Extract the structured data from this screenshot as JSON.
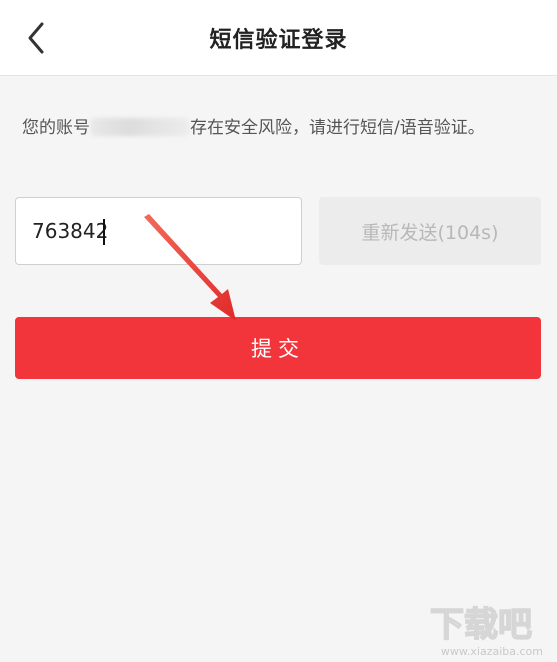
{
  "header": {
    "title": "短信验证登录",
    "back_icon": "chevron-left-icon"
  },
  "notice": {
    "prefix": "您的账号",
    "suffix": "存在安全风险，请进行短信/语音验证。"
  },
  "code_input": {
    "value": "763842",
    "placeholder": ""
  },
  "resend_button": {
    "label": "重新发送(104s)"
  },
  "submit_button": {
    "label": "提交"
  },
  "watermark": {
    "brand": "下载吧",
    "url": "www.xiazaiba.com"
  },
  "colors": {
    "primary": "#f2353b",
    "header_bg": "#ffffff",
    "page_bg": "#f5f5f5",
    "disabled_bg": "#ececec",
    "disabled_text": "#b8b8b8",
    "annotation_arrow": "#e8312f"
  }
}
